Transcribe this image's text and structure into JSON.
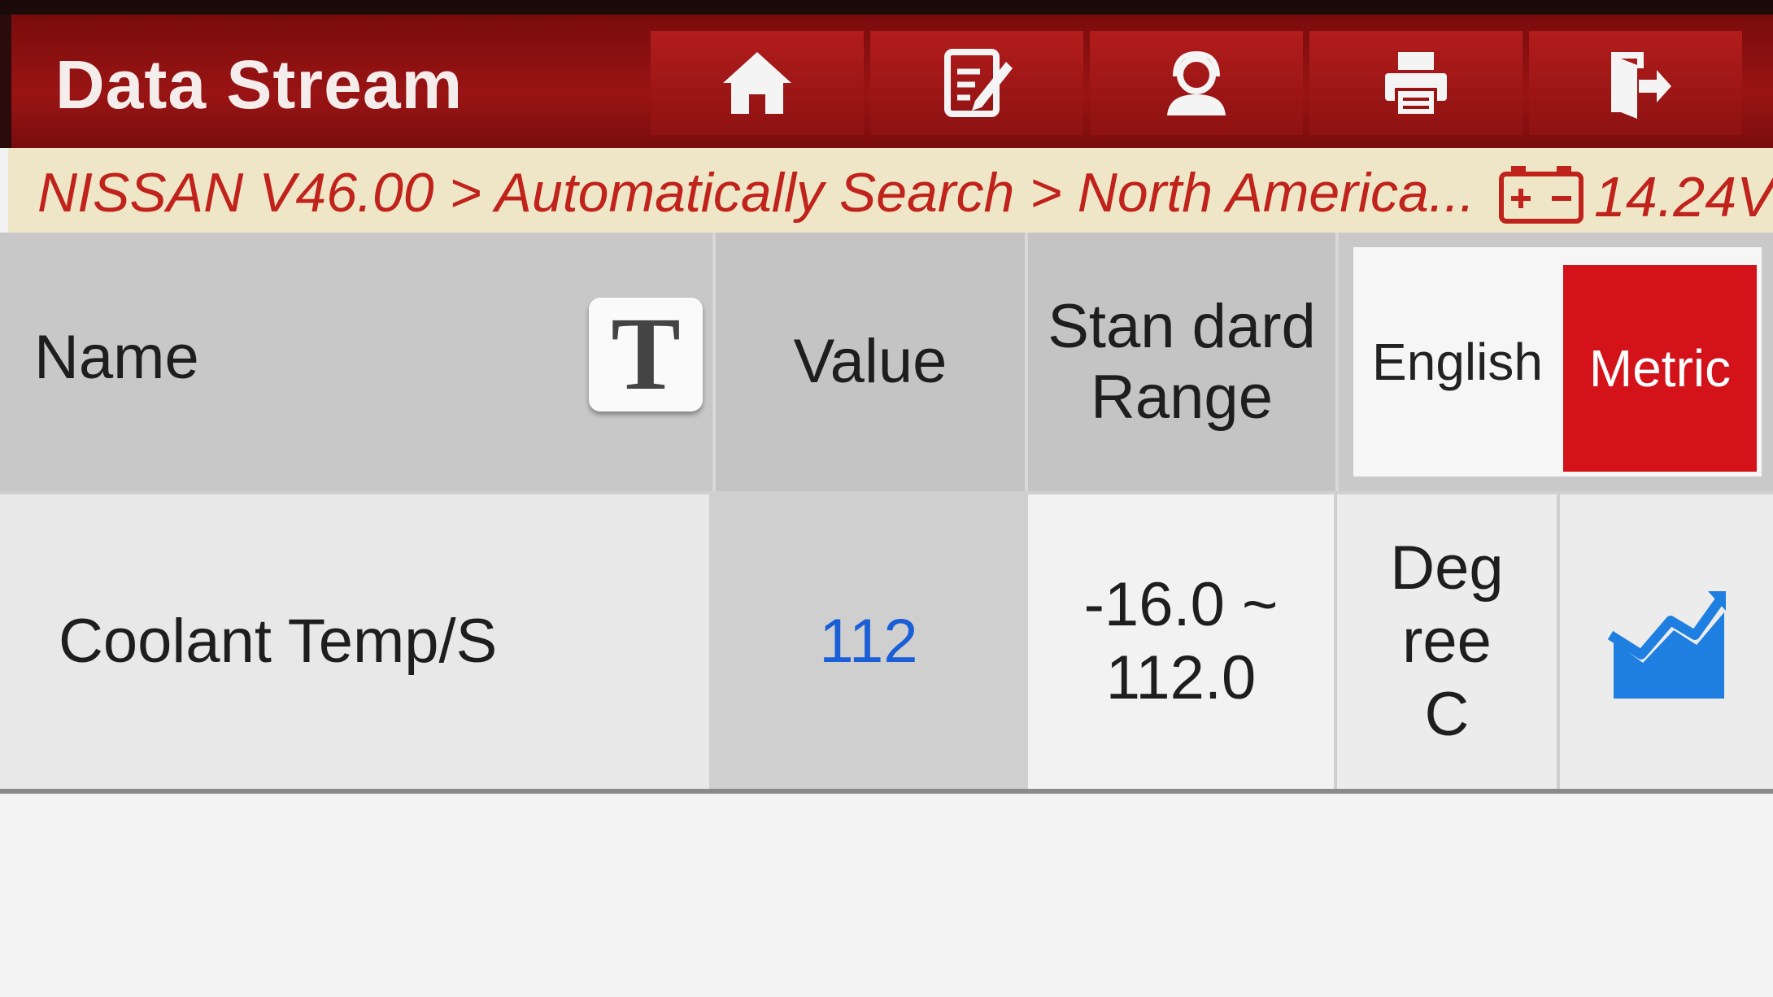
{
  "header": {
    "title": "Data Stream",
    "toolbar": [
      {
        "icon": "home-icon"
      },
      {
        "icon": "edit-report-icon"
      },
      {
        "icon": "user-support-icon"
      },
      {
        "icon": "printer-icon"
      },
      {
        "icon": "exit-icon"
      }
    ]
  },
  "breadcrumb": {
    "path": "NISSAN V46.00 > Automatically Search > North America...",
    "battery_icon": "battery-icon",
    "voltage": "14.24V"
  },
  "table": {
    "columns": {
      "name": "Name",
      "value": "Value",
      "range": "Stan dard Range",
      "unit_english": "English",
      "unit_metric": "Metric"
    },
    "text_size_button": "T",
    "selected_unit": "Metric",
    "rows": [
      {
        "name": "Coolant Temp/S",
        "value": "112",
        "range": "-16.0 ~ 112.0",
        "unit": "Deg ree C",
        "graph_icon": "graph-icon"
      }
    ]
  },
  "colors": {
    "header_red": "#9a1414",
    "breadcrumb_text": "#c0231b",
    "metric_active": "#d4121a",
    "value_blue": "#1a5fd6",
    "graph_icon": "#1e7fe0"
  }
}
